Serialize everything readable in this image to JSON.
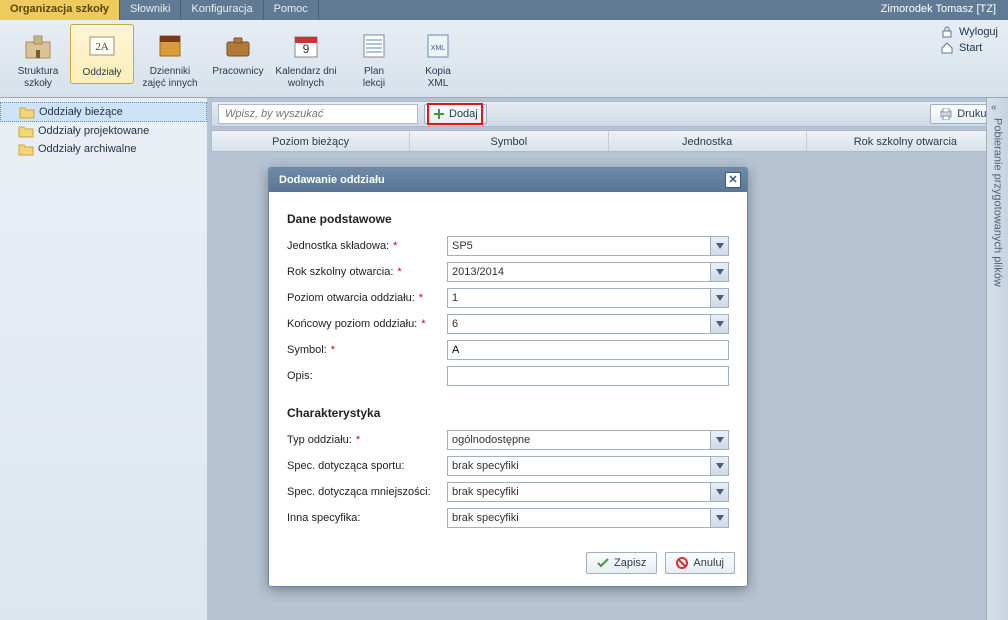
{
  "menubar": {
    "tabs": [
      "Organizacja szkoły",
      "Słowniki",
      "Konfiguracja",
      "Pomoc"
    ],
    "user": "Zimorodek Tomasz [TZ]"
  },
  "ribbon": {
    "items": [
      {
        "label1": "Struktura",
        "label2": "szkoły"
      },
      {
        "label1": "Oddziały",
        "label2": ""
      },
      {
        "label1": "Dzienniki",
        "label2": "zajęć innych"
      },
      {
        "label1": "Pracownicy",
        "label2": ""
      },
      {
        "label1": "Kalendarz dni",
        "label2": "wolnych"
      },
      {
        "label1": "Plan",
        "label2": "lekcji"
      },
      {
        "label1": "Kopia",
        "label2": "XML"
      }
    ],
    "logout": "Wyloguj",
    "start": "Start"
  },
  "sidebar": {
    "items": [
      "Oddziały bieżące",
      "Oddziały projektowane",
      "Oddziały archiwalne"
    ]
  },
  "toolbar": {
    "search_placeholder": "Wpisz, by wyszukać",
    "dodaj": "Dodaj",
    "print": "Drukuj"
  },
  "table": {
    "cols": [
      "Poziom bieżący",
      "Symbol",
      "Jednostka",
      "Rok szkolny otwarcia"
    ]
  },
  "right_panel": {
    "label": "Pobieranie przygotowanych plików"
  },
  "dialog": {
    "title": "Dodawanie oddziału",
    "section1": "Dane podstawowe",
    "section2": "Charakterystyka",
    "labels": {
      "jednostka": "Jednostka składowa:",
      "rok": "Rok szkolny otwarcia:",
      "poziom_otw": "Poziom otwarcia oddziału:",
      "poziom_kon": "Końcowy poziom oddziału:",
      "symbol": "Symbol:",
      "opis": "Opis:",
      "typ": "Typ oddziału:",
      "sport": "Spec. dotycząca sportu:",
      "mniejszosc": "Spec. dotycząca mniejszości:",
      "inna": "Inna specyfika:"
    },
    "values": {
      "jednostka": "SP5",
      "rok": "2013/2014",
      "poziom_otw": "1",
      "poziom_kon": "6",
      "symbol": "A",
      "opis": "",
      "typ": "ogólnodostępne",
      "sport": "brak specyfiki",
      "mniejszosc": "brak specyfiki",
      "inna": "brak specyfiki"
    },
    "required_mark": "*",
    "save": "Zapisz",
    "cancel": "Anuluj"
  }
}
